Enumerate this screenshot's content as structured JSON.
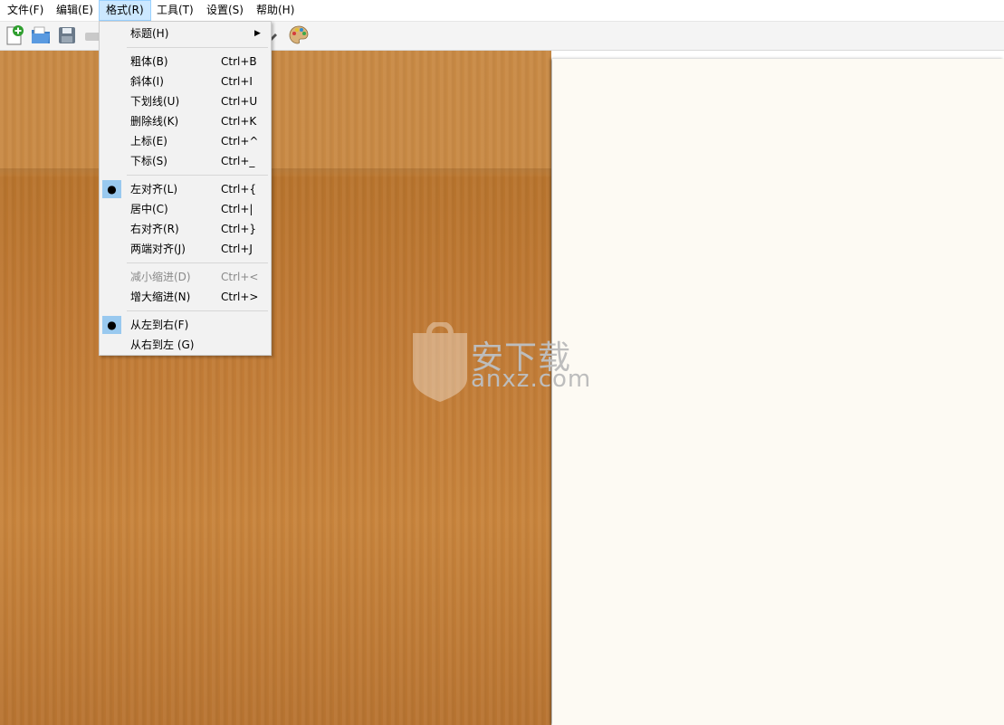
{
  "menubar": {
    "items": [
      "文件(F)",
      "编辑(E)",
      "格式(R)",
      "工具(T)",
      "设置(S)",
      "帮助(H)"
    ],
    "open_index": 2
  },
  "toolbar": {
    "icons": [
      "new-document-icon",
      "open-folder-icon",
      "save-icon",
      "print-icon",
      "palette-icon"
    ]
  },
  "format_menu": {
    "heading": {
      "label": "标题(H)"
    },
    "bold": {
      "label": "粗体(B)",
      "shortcut": "Ctrl+B"
    },
    "italic": {
      "label": "斜体(I)",
      "shortcut": "Ctrl+I"
    },
    "underline": {
      "label": "下划线(U)",
      "shortcut": "Ctrl+U"
    },
    "strikethrough": {
      "label": "删除线(K)",
      "shortcut": "Ctrl+K"
    },
    "superscript": {
      "label": "上标(E)",
      "shortcut": "Ctrl+^"
    },
    "subscript": {
      "label": "下标(S)",
      "shortcut": "Ctrl+_"
    },
    "align_left": {
      "label": "左对齐(L)",
      "shortcut": "Ctrl+{",
      "checked": true
    },
    "align_center": {
      "label": "居中(C)",
      "shortcut": "Ctrl+|"
    },
    "align_right": {
      "label": "右对齐(R)",
      "shortcut": "Ctrl+}"
    },
    "justify": {
      "label": "两端对齐(J)",
      "shortcut": "Ctrl+J"
    },
    "decrease_indent": {
      "label": "减小缩进(D)",
      "shortcut": "Ctrl+<",
      "disabled": true
    },
    "increase_indent": {
      "label": "增大缩进(N)",
      "shortcut": "Ctrl+>"
    },
    "ltr": {
      "label": "从左到右(F)",
      "checked": true
    },
    "rtl": {
      "label": "从右到左 (G)"
    }
  },
  "watermark": {
    "text": "安下载",
    "sub": "anxz.com",
    "shield_char": "安"
  },
  "colors": {
    "menu_highlight": "#cce8ff",
    "check_bg": "#99c9ef",
    "paper": "#fdfaf3",
    "wood": "#c07a35"
  }
}
